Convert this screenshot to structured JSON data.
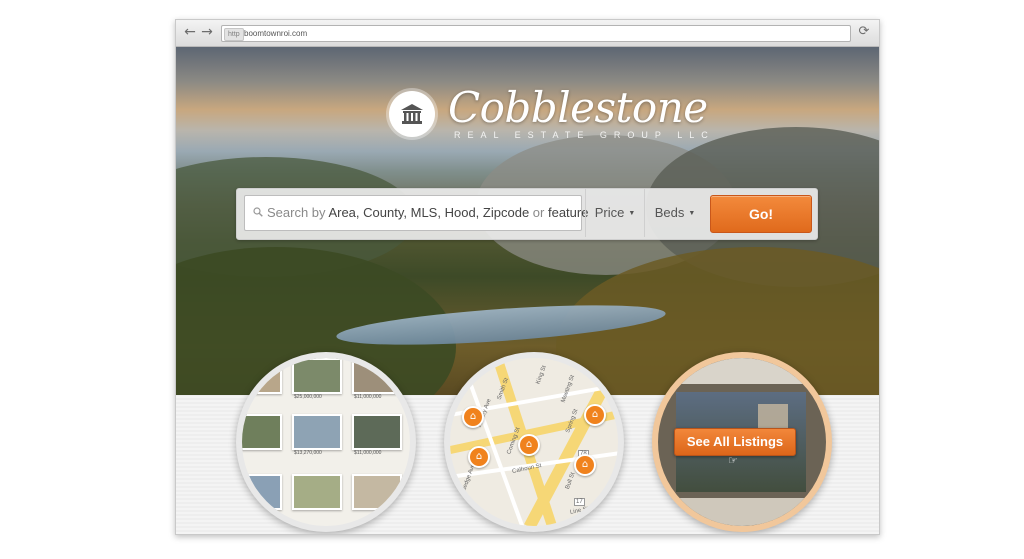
{
  "browser": {
    "back_icon": "arrow-left-icon",
    "forward_icon": "arrow-right-icon",
    "protocol": "http",
    "url": "boomtownroi.com",
    "reload_icon": "reload-icon"
  },
  "hero": {
    "logo_icon": "bank-building-icon",
    "brand_name": "Cobblestone",
    "brand_sub": "REAL ESTATE GROUP LLC"
  },
  "search": {
    "placeholder_prefix": "Search by",
    "placeholder_terms": [
      "Area,",
      "County,",
      "MLS,",
      "Hood,",
      "Zipcode"
    ],
    "placeholder_or": "or",
    "placeholder_last": "feature",
    "price_label": "Price",
    "beds_label": "Beds",
    "go_label": "Go!"
  },
  "features": {
    "grid_prices": [
      "$25,000,000",
      "$11,000,000",
      "$13,270,000",
      "$11,000,000"
    ],
    "map_streets": [
      "King St",
      "Rutledge Ave",
      "Meeting St",
      "Ashley Ave",
      "Smith St",
      "Calhoun St",
      "Spring St",
      "Coming St",
      "Bull St",
      "Line St"
    ],
    "map_shields": [
      "78",
      "17"
    ],
    "listings_button": "See All Listings"
  },
  "colors": {
    "accent": "#ee7a2a",
    "map_road": "#f6d776"
  }
}
